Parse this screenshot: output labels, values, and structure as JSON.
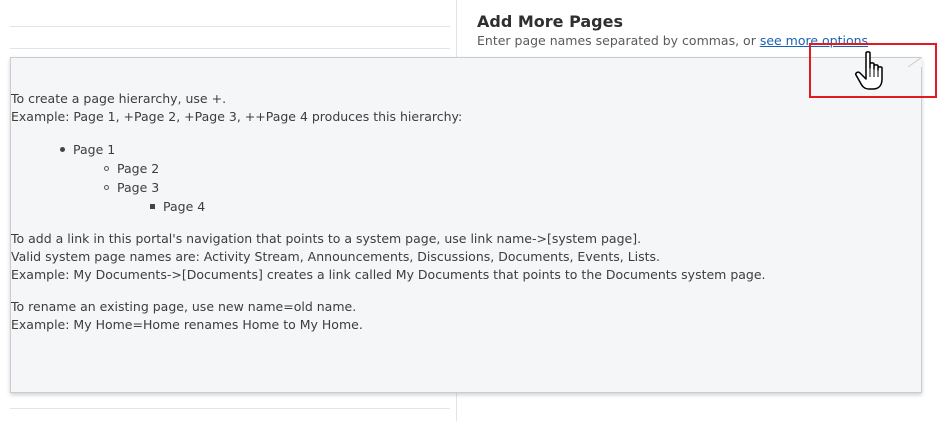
{
  "header": {
    "title": "Add More Pages",
    "description_prefix": "Enter page names separated by commas, or ",
    "see_more_link": "see more options"
  },
  "popup": {
    "hierarchy_intro": "To create a page hierarchy, use +.",
    "hierarchy_example": "Example: Page 1, +Page 2, +Page 3, ++Page 4 produces this hierarchy:",
    "tree": [
      {
        "label": "Page 1",
        "level": 1
      },
      {
        "label": "Page 2",
        "level": 2
      },
      {
        "label": "Page 3",
        "level": 2
      },
      {
        "label": "Page 4",
        "level": 3
      }
    ],
    "link_intro": "To add a link in this portal's navigation that points to a system page, use link name->[system page].",
    "link_valid_names": "Valid system page names are: Activity Stream, Announcements, Discussions, Documents, Events, Lists.",
    "link_example": "Example: My Documents->[Documents] creates a link called My Documents that points to the Documents system page.",
    "rename_intro": "To rename an existing page, use new name=old name.",
    "rename_example": "Example: My Home=Home renames Home to My Home."
  },
  "icons": {
    "cursor": "hand-pointer-icon",
    "caret": "popup-caret-icon"
  },
  "colors": {
    "link": "#1a62b5",
    "highlight": "#e01b24",
    "popup_background": "#f5f6f7"
  }
}
